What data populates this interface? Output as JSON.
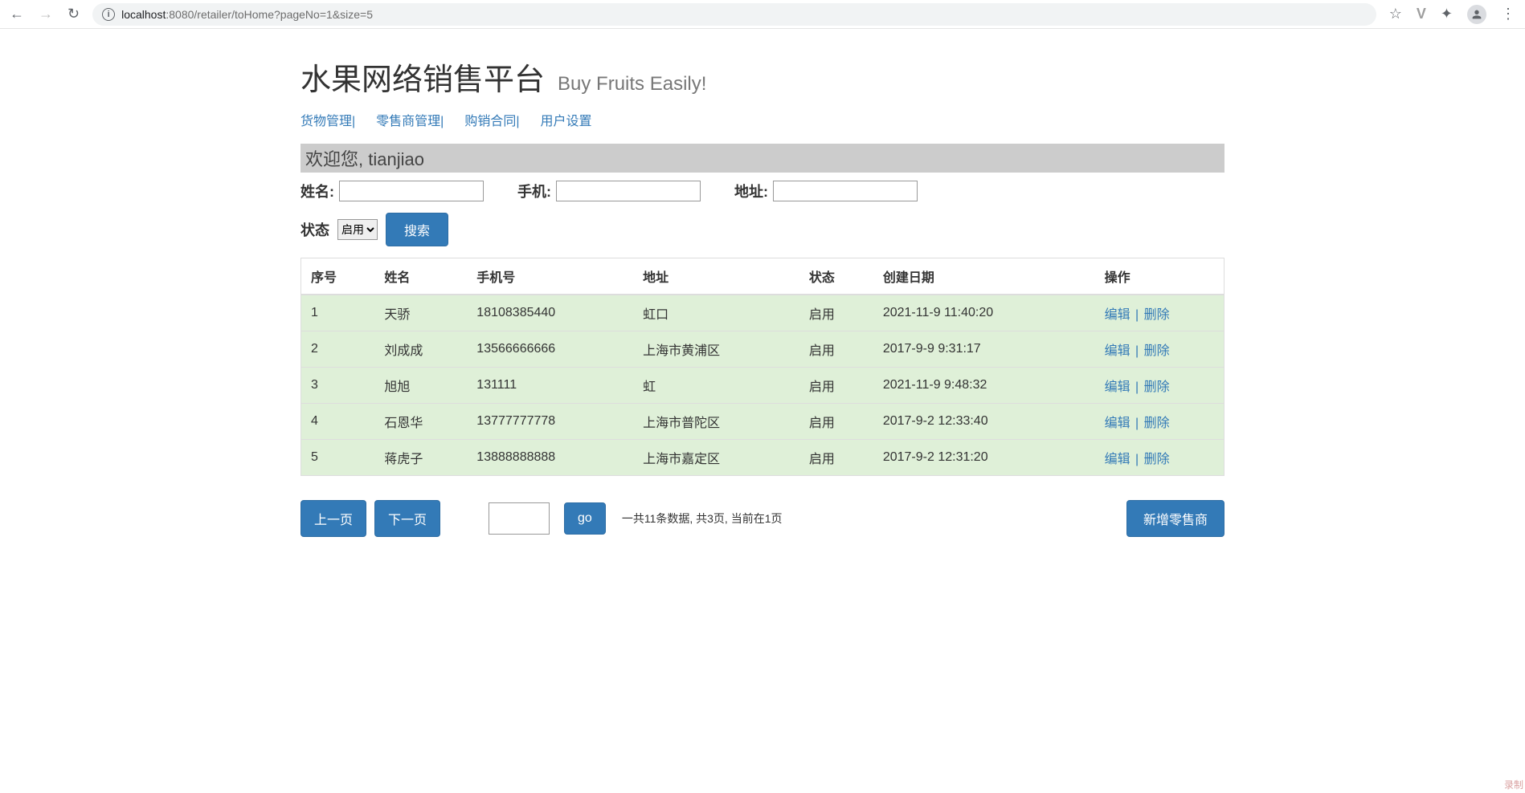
{
  "browser": {
    "host": "localhost",
    "port": ":8080",
    "path": "/retailer/toHome?pageNo=1&size=5"
  },
  "header": {
    "title": "水果网络销售平台",
    "subtitle": "Buy Fruits Easily!"
  },
  "nav": {
    "items": [
      {
        "label": "货物管理|"
      },
      {
        "label": "零售商管理|"
      },
      {
        "label": "购销合同|"
      },
      {
        "label": "用户设置"
      }
    ]
  },
  "welcome": {
    "prefix": "欢迎您, ",
    "user": "tianjiao"
  },
  "filters": {
    "name_label": "姓名:",
    "name_value": "",
    "phone_label": "手机:",
    "phone_value": "",
    "address_label": "地址:",
    "address_value": "",
    "status_label": "状态",
    "status_selected": "启用",
    "search_label": "搜索"
  },
  "table": {
    "headers": {
      "index": "序号",
      "name": "姓名",
      "phone": "手机号",
      "address": "地址",
      "status": "状态",
      "created": "创建日期",
      "ops": "操作"
    },
    "edit_label": "编辑",
    "delete_label": "删除",
    "rows": [
      {
        "index": "1",
        "name": "天骄",
        "phone": "18108385440",
        "address": "虹口",
        "status": "启用",
        "created": "2021-11-9 11:40:20"
      },
      {
        "index": "2",
        "name": "刘成成",
        "phone": "13566666666",
        "address": "上海市黄浦区",
        "status": "启用",
        "created": "2017-9-9 9:31:17"
      },
      {
        "index": "3",
        "name": "旭旭",
        "phone": "131111",
        "address": "虹",
        "status": "启用",
        "created": "2021-11-9 9:48:32"
      },
      {
        "index": "4",
        "name": "石恩华",
        "phone": "13777777778",
        "address": "上海市普陀区",
        "status": "启用",
        "created": "2017-9-2 12:33:40"
      },
      {
        "index": "5",
        "name": "蒋虎子",
        "phone": "13888888888",
        "address": "上海市嘉定区",
        "status": "启用",
        "created": "2017-9-2 12:31:20"
      }
    ]
  },
  "pager": {
    "prev_label": "上一页",
    "next_label": "下一页",
    "page_value": "",
    "go_label": "go",
    "info": "一共11条数据, 共3页, 当前在1页",
    "add_label": "新增零售商"
  },
  "corner": "录制"
}
